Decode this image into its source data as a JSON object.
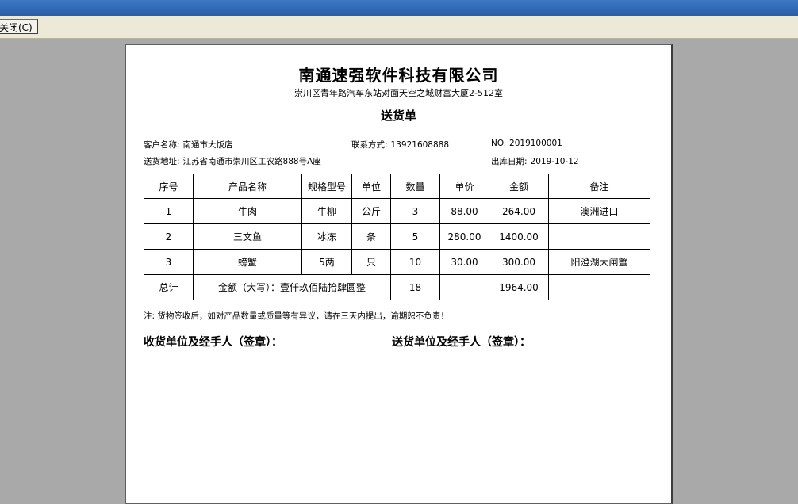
{
  "toolbar": {
    "close_label": "关闭(C)"
  },
  "document": {
    "company": "南通速强软件科技有限公司",
    "address": "崇川区青年路汽车东站对面天空之城财富大厦2-512室",
    "title": "送货单",
    "customer_label": "客户名称:",
    "customer": "南通市大饭店",
    "contact_label": "联系方式:",
    "contact": "13921608888",
    "no_label": "NO.",
    "no": "2019100001",
    "address_label": "送货地址:",
    "delivery_address": "江苏省南通市崇川区工农路888号A座",
    "date_label": "出库日期:",
    "date": "2019-10-12",
    "headers": [
      "序号",
      "产品名称",
      "规格型号",
      "单位",
      "数量",
      "单价",
      "金额",
      "备注"
    ],
    "rows": [
      [
        "1",
        "牛肉",
        "牛柳",
        "公斤",
        "3",
        "88.00",
        "264.00",
        "澳洲进口"
      ],
      [
        "2",
        "三文鱼",
        "冰冻",
        "条",
        "5",
        "280.00",
        "1400.00",
        ""
      ],
      [
        "3",
        "螃蟹",
        "5两",
        "只",
        "10",
        "30.00",
        "300.00",
        "阳澄湖大闸蟹"
      ]
    ],
    "total": {
      "label": "总计",
      "amount_words": "金额（大写）：壹仟玖佰陆拾肆圆整",
      "qty": "18",
      "price": "",
      "amount": "1964.00",
      "remark": ""
    },
    "note": "注: 货物签收后，如对产品数量或质量等有异议，请在三天内提出，逾期恕不负责！",
    "receiver_sign": "收货单位及经手人（签章）：",
    "sender_sign": "送货单位及经手人（签章）："
  }
}
